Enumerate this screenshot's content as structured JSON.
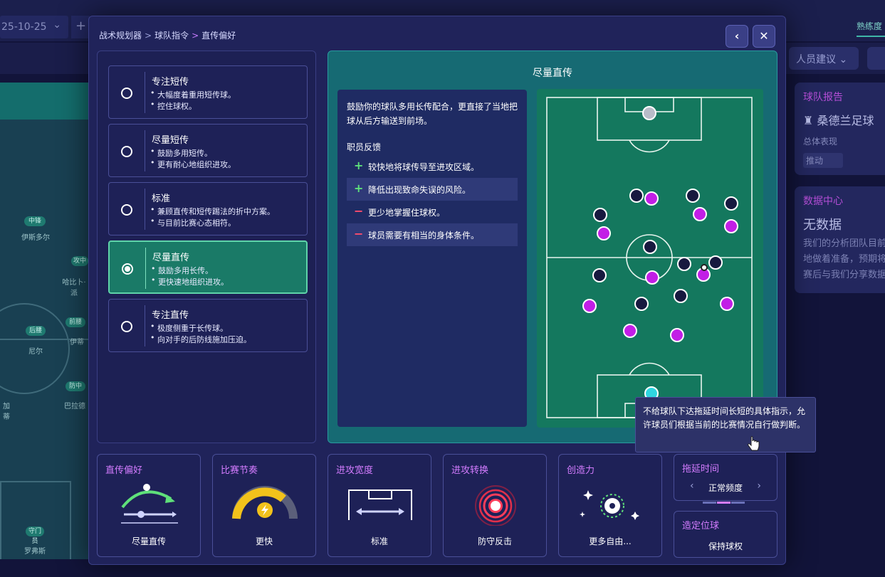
{
  "background": {
    "date_value": "25-10-25",
    "plus_label": "+",
    "right_tab": "熟练度",
    "dropdown_label": "人员建议",
    "pitch_players": [
      {
        "chip": "中锋",
        "name": "伊斯多尔"
      },
      {
        "chip": "攻中",
        "name": "哈比卜·派"
      },
      {
        "chip": "后腰",
        "name": "尼尔"
      },
      {
        "chip": "前腰",
        "name": "伊蒂"
      },
      {
        "chip": "防中",
        "name": "巴拉德"
      },
      {
        "chip": "",
        "name": "加蒂"
      },
      {
        "chip": "守门员",
        "name": "罗弗斯"
      }
    ],
    "team_report": {
      "title": "球队报告",
      "team": "桑德兰足球",
      "label": "总体表现",
      "badge": "推动"
    },
    "data_center": {
      "title": "数据中心",
      "big": "无数据",
      "lines": [
        "我们的分析团队目前",
        "地做着准备，预期将",
        "赛后与我们分享数据"
      ]
    }
  },
  "breadcrumb": [
    "战术规划器",
    "球队指令",
    "直传偏好"
  ],
  "options": [
    {
      "title": "专注短传",
      "bullets": [
        "大幅度着重用短传球。",
        "控住球权。"
      ],
      "selected": false
    },
    {
      "title": "尽量短传",
      "bullets": [
        "鼓励多用短传。",
        "更有耐心地组织进攻。"
      ],
      "selected": false
    },
    {
      "title": "标准",
      "bullets": [
        "兼顾直传和短传踢法的折中方案。",
        "与目前比赛心态相符。"
      ],
      "selected": false
    },
    {
      "title": "尽量直传",
      "bullets": [
        "鼓励多用长传。",
        "更快速地组织进攻。"
      ],
      "selected": true
    },
    {
      "title": "专注直传",
      "bullets": [
        "极度侧重于长传球。",
        "向对手的后防线施加压迫。"
      ],
      "selected": false
    }
  ],
  "detail": {
    "title": "尽量直传",
    "description": "鼓励你的球队多用长传配合，更直接了当地把球从后方输送到前场。",
    "feedback_title": "职员反馈",
    "feedback": [
      {
        "sign": "+",
        "type": "positive",
        "text": "较快地将球传导至进攻区域。"
      },
      {
        "sign": "+",
        "type": "positive",
        "text": "降低出现致命失误的风险。"
      },
      {
        "sign": "−",
        "type": "negative",
        "text": "更少地掌握住球权。"
      },
      {
        "sign": "−",
        "type": "negative",
        "text": "球员需要有相当的身体条件。"
      }
    ]
  },
  "tooltip": "不给球队下达拖延时间长短的具体指示，允许球员们根据当前的比赛情况自行做判断。",
  "tiles": [
    {
      "title": "直传偏好",
      "value": "尽量直传"
    },
    {
      "title": "比赛节奏",
      "value": "更快"
    },
    {
      "title": "进攻宽度",
      "value": "标准"
    },
    {
      "title": "进攻转换",
      "value": "防守反击"
    },
    {
      "title": "创造力",
      "value": "更多自由..."
    }
  ],
  "small_tiles": [
    {
      "title": "拖延时间",
      "value": "正常频度",
      "level": 2,
      "levels": 3
    },
    {
      "title": "造定位球",
      "value": "保持球权"
    }
  ],
  "colors": {
    "accent": "#d47cff",
    "selected": "#1a7a67",
    "pitch": "#14785e",
    "team_dark": "#17193f",
    "team_purple": "#c21ee6"
  }
}
